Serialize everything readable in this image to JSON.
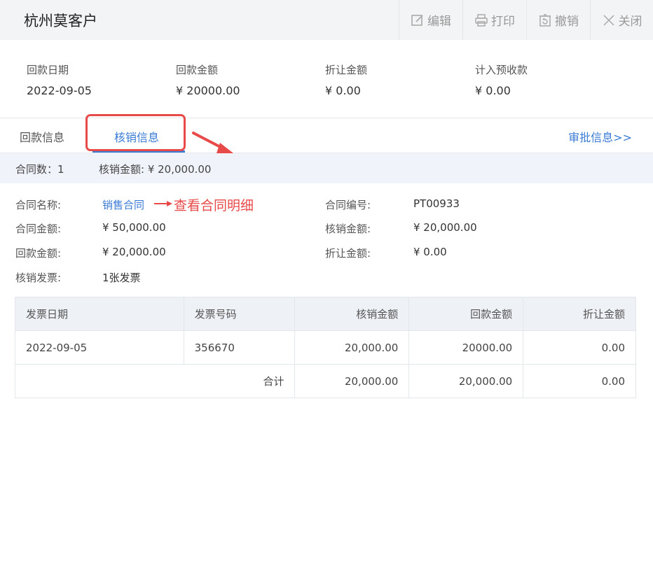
{
  "header": {
    "title": "杭州莫客户",
    "toolbar": [
      {
        "label": "编辑",
        "icon": "edit-icon"
      },
      {
        "label": "打印",
        "icon": "printer-icon"
      },
      {
        "label": "撤销",
        "icon": "revoke-icon"
      },
      {
        "label": "关闭",
        "icon": "close-icon"
      }
    ]
  },
  "summary": [
    {
      "label": "回款日期",
      "value": "2022-09-05"
    },
    {
      "label": "回款金额",
      "value": "¥ 20000.00"
    },
    {
      "label": "折让金额",
      "value": "¥ 0.00"
    },
    {
      "label": "计入预收款",
      "value": "¥ 0.00"
    }
  ],
  "tabs": {
    "repay": "回款信息",
    "writeoff": "核销信息",
    "approval": "审批信息>>"
  },
  "stats": {
    "contract_count": "合同数：1",
    "writeoff_amount": "核销金额: ¥ 20,000.00"
  },
  "detail": {
    "contract_name_label": "合同名称:",
    "contract_name_value": "销售合同",
    "annotation": "查看合同明细",
    "contract_no_label": "合同编号:",
    "contract_no_value": "PT00933",
    "contract_amount_label": "合同金额:",
    "contract_amount_value": "¥ 50,000.00",
    "writeoff_amount_label": "核销金额:",
    "writeoff_amount_value": "¥ 20,000.00",
    "repay_amount_label": "回款金额:",
    "repay_amount_value": "¥ 20,000.00",
    "discount_amount_label": "折让金额:",
    "discount_amount_value": "¥ 0.00",
    "invoice_label": "核销发票:",
    "invoice_value": "1张发票"
  },
  "table": {
    "headers": [
      "发票日期",
      "发票号码",
      "核销金额",
      "回款金额",
      "折让金额"
    ],
    "rows": [
      [
        "2022-09-05",
        "356670",
        "20,000.00",
        "20000.00",
        "0.00"
      ]
    ],
    "total": {
      "label": "合计",
      "writeoff": "20,000.00",
      "repay": "20,000.00",
      "discount": "0.00"
    }
  },
  "colors": {
    "accent": "#3a7bd5",
    "annotation": "#e84a4a"
  }
}
